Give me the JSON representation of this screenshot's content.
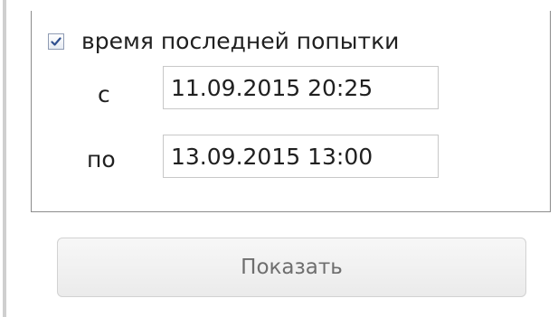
{
  "filter": {
    "checkbox_checked": true,
    "checkbox_label": "время последней попытки",
    "from_label": "с",
    "from_value": "11.09.2015 20:25",
    "to_label": "по",
    "to_value": "13.09.2015 13:00"
  },
  "actions": {
    "show_label": "Показать"
  },
  "colors": {
    "panel_border": "#8c8c8c",
    "input_border": "#c8c8c8",
    "check_mark": "#2f4f8f",
    "button_text": "#6e6e6e"
  },
  "icons": {
    "checkbox": "checkmark-icon"
  }
}
